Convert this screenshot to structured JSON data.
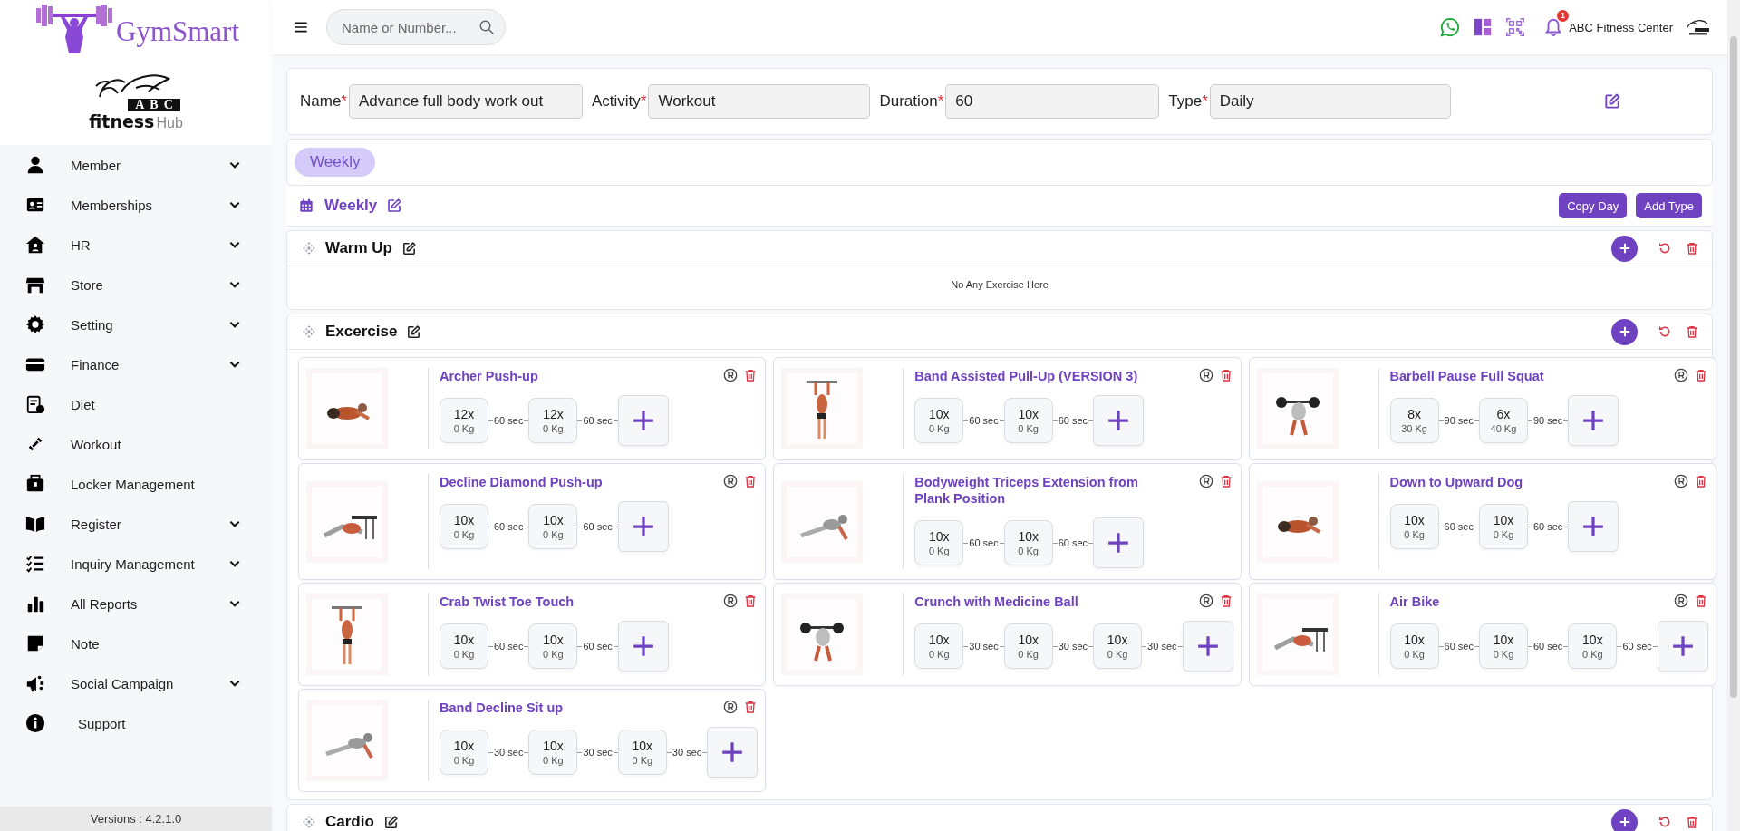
{
  "brand": {
    "name": "GymSmart"
  },
  "gym_logo": {
    "badge": "ABC",
    "name": "fitness",
    "suffix": "Hub"
  },
  "header": {
    "search": {
      "placeholder": "Name or Number..."
    },
    "notification_count": "1",
    "center_name": "ABC Fitness Center"
  },
  "sidebar": {
    "items": [
      {
        "label": "Member",
        "expandable": true
      },
      {
        "label": "Memberships",
        "expandable": true
      },
      {
        "label": "HR",
        "expandable": true
      },
      {
        "label": "Store",
        "expandable": true
      },
      {
        "label": "Setting",
        "expandable": true
      },
      {
        "label": "Finance",
        "expandable": true
      },
      {
        "label": "Diet",
        "expandable": false
      },
      {
        "label": "Workout",
        "expandable": false
      },
      {
        "label": "Locker Management",
        "expandable": false
      },
      {
        "label": "Register",
        "expandable": true
      },
      {
        "label": "Inquiry Management",
        "expandable": true
      },
      {
        "label": "All Reports",
        "expandable": true
      },
      {
        "label": "Note",
        "expandable": false
      },
      {
        "label": "Social Campaign",
        "expandable": true
      },
      {
        "label": "Support",
        "expandable": false
      }
    ],
    "version": "Versions : 4.2.1.0"
  },
  "form": {
    "fields": [
      {
        "label": "Name",
        "required_mark": "*",
        "value": "Advance full body work out"
      },
      {
        "label": "Activity",
        "required_mark": "*",
        "value": "Workout"
      },
      {
        "label": "Duration",
        "required_mark": "*",
        "value": "60"
      },
      {
        "label": "Type",
        "required_mark": "*",
        "value": "Daily"
      }
    ]
  },
  "tabs": [
    {
      "label": "Weekly",
      "selected": true
    }
  ],
  "day": {
    "title": "Weekly",
    "buttons": [
      "Copy Day",
      "Add Type"
    ]
  },
  "sections": [
    {
      "title": "Warm Up",
      "empty_text": "No Any Exercise Here"
    },
    {
      "title": "Excercise",
      "exercises": [
        {
          "name": "Archer Push-up",
          "sets": [
            {
              "reps": "12x",
              "weight": "0 Kg",
              "rest": "60 sec"
            },
            {
              "reps": "12x",
              "weight": "0 Kg",
              "rest": "60 sec"
            }
          ]
        },
        {
          "name": "Band Assisted Pull-Up (VERSION 3)",
          "sets": [
            {
              "reps": "10x",
              "weight": "0 Kg",
              "rest": "60 sec"
            },
            {
              "reps": "10x",
              "weight": "0 Kg",
              "rest": "60 sec"
            }
          ]
        },
        {
          "name": "Barbell Pause Full Squat",
          "sets": [
            {
              "reps": "8x",
              "weight": "30 Kg",
              "rest": "90 sec"
            },
            {
              "reps": "6x",
              "weight": "40 Kg",
              "rest": "90 sec"
            }
          ]
        },
        {
          "name": "Decline Diamond Push-up",
          "sets": [
            {
              "reps": "10x",
              "weight": "0 Kg",
              "rest": "60 sec"
            },
            {
              "reps": "10x",
              "weight": "0 Kg",
              "rest": "60 sec"
            }
          ]
        },
        {
          "name": "Bodyweight Triceps Extension from Plank Position",
          "sets": [
            {
              "reps": "10x",
              "weight": "0 Kg",
              "rest": "60 sec"
            },
            {
              "reps": "10x",
              "weight": "0 Kg",
              "rest": "60 sec"
            }
          ]
        },
        {
          "name": "Down to Upward Dog",
          "sets": [
            {
              "reps": "10x",
              "weight": "0 Kg",
              "rest": "60 sec"
            },
            {
              "reps": "10x",
              "weight": "0 Kg",
              "rest": "60 sec"
            }
          ]
        },
        {
          "name": "Crab Twist Toe Touch",
          "sets": [
            {
              "reps": "10x",
              "weight": "0 Kg",
              "rest": "60 sec"
            },
            {
              "reps": "10x",
              "weight": "0 Kg",
              "rest": "60 sec"
            }
          ]
        },
        {
          "name": "Crunch with Medicine Ball",
          "sets": [
            {
              "reps": "10x",
              "weight": "0 Kg",
              "rest": "30 sec"
            },
            {
              "reps": "10x",
              "weight": "0 Kg",
              "rest": "30 sec"
            },
            {
              "reps": "10x",
              "weight": "0 Kg",
              "rest": "30 sec"
            }
          ]
        },
        {
          "name": "Air Bike",
          "sets": [
            {
              "reps": "10x",
              "weight": "0 Kg",
              "rest": "60 sec"
            },
            {
              "reps": "10x",
              "weight": "0 Kg",
              "rest": "60 sec"
            },
            {
              "reps": "10x",
              "weight": "0 Kg",
              "rest": "60 sec"
            }
          ]
        },
        {
          "name": "Band Decline Sit up",
          "sets": [
            {
              "reps": "10x",
              "weight": "0 Kg",
              "rest": "30 sec"
            },
            {
              "reps": "10x",
              "weight": "0 Kg",
              "rest": "30 sec"
            },
            {
              "reps": "10x",
              "weight": "0 Kg",
              "rest": "30 sec"
            }
          ]
        }
      ]
    },
    {
      "title": "Cardio"
    }
  ]
}
